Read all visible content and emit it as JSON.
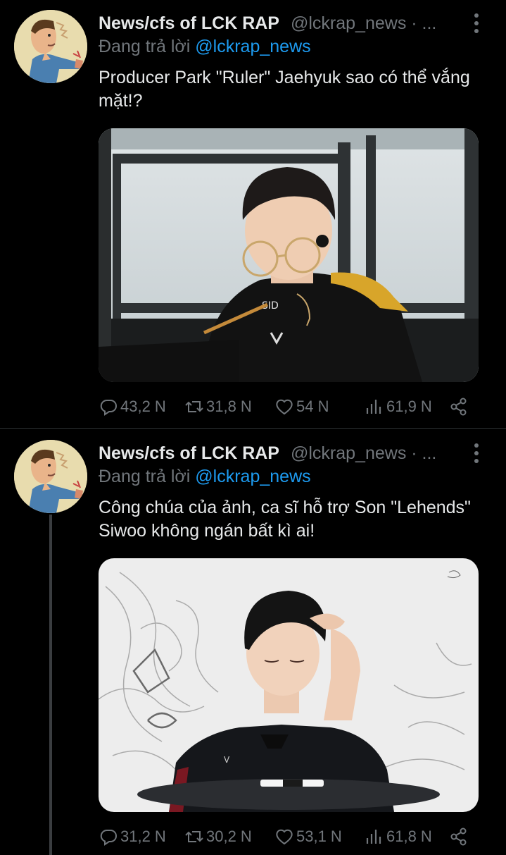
{
  "tweets": [
    {
      "author_name": "News/cfs of LCK RAP",
      "author_handle": "@lckrap_news · ...",
      "reply_prefix": "Đang trả lời",
      "reply_to": "@lckrap_news",
      "text": "Producer Park \"Ruler\" Jaehyuk sao có thể vắng mặt!?",
      "stats": {
        "replies": "43,2 N",
        "retweets": "31,8 N",
        "likes": "54 N",
        "views": "61,9 N"
      }
    },
    {
      "author_name": "News/cfs of LCK RAP",
      "author_handle": "@lckrap_news · ...",
      "reply_prefix": "Đang trả lời",
      "reply_to": "@lckrap_news",
      "text": "Công chúa của ảnh, ca sĩ hỗ trợ Son \"Lehends\" Siwoo không ngán bất kì ai!",
      "stats": {
        "replies": "31,2 N",
        "retweets": "30,2 N",
        "likes": "53,1 N",
        "views": "61,8 N"
      }
    }
  ],
  "colors": {
    "background": "#000000",
    "text": "#e7e9ea",
    "secondary": "#71767b",
    "mention": "#1d9bf0"
  },
  "icons": [
    "more-icon",
    "reply-icon",
    "retweet-icon",
    "like-icon",
    "views-icon",
    "share-icon"
  ]
}
